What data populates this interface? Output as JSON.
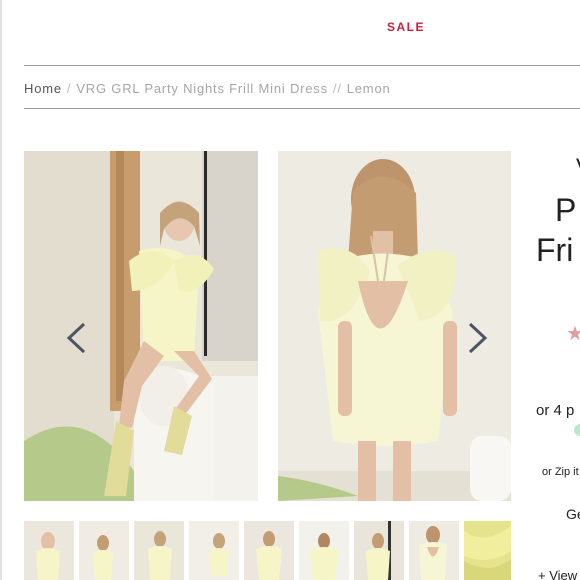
{
  "nav": {
    "sale_label": "SALE"
  },
  "breadcrumb": {
    "home": "Home",
    "separator": "/",
    "product": "VRG GRL Party Nights Frill Mini Dress",
    "separator2": "//",
    "variant": "Lemon"
  },
  "gallery": {
    "prev_icon": "chevron-left-icon",
    "next_icon": "chevron-right-icon",
    "thumbnail_count": 9
  },
  "product_panel": {
    "title_line1": "V",
    "title_line2": "P",
    "title_line3": "Fri",
    "rating_icon": "star-icon",
    "installments_text": "or 4 p",
    "zip_text": "or Zip it",
    "size_text": "Ge",
    "view_text": "+ View"
  },
  "colors": {
    "sale": "#c8203a",
    "dress": "#f6f5c8",
    "backdrop": "#e9e3d6"
  }
}
